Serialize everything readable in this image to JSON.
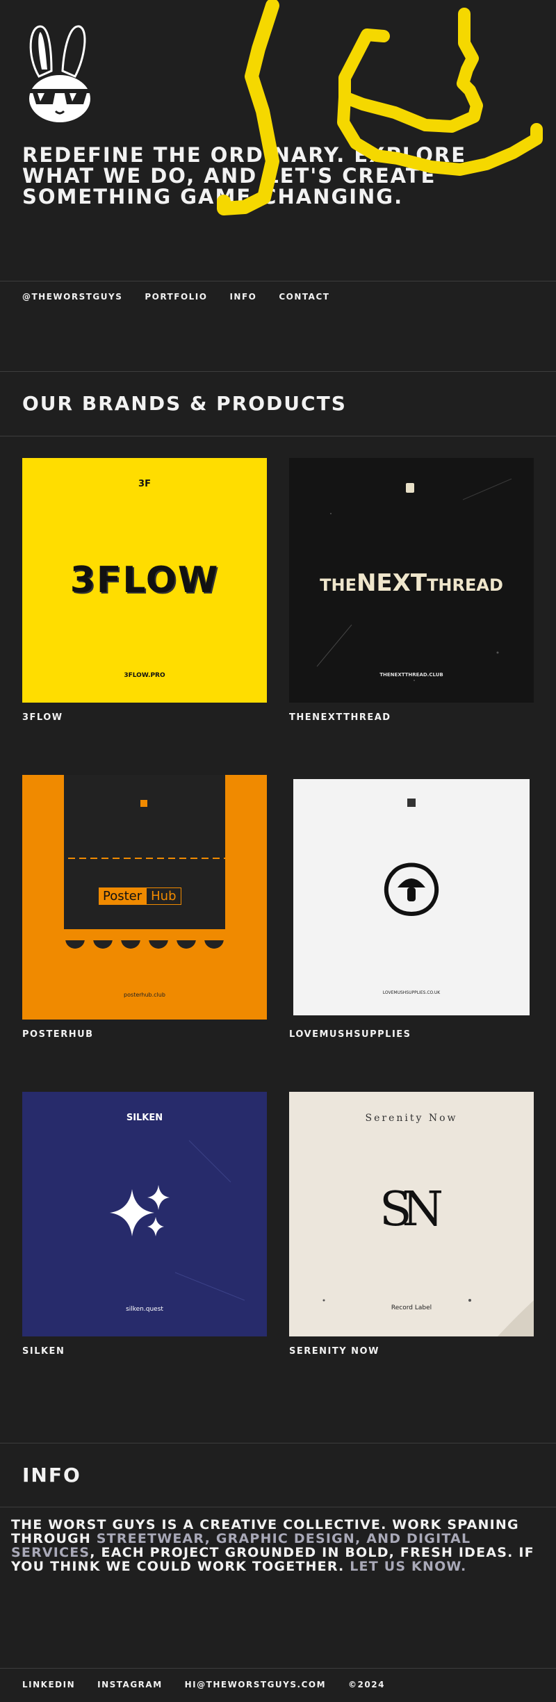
{
  "header": {
    "logo_name": "bunny-with-sunglasses-logo",
    "headline": "Redefine the ordinary. Explore what we do, and let's create something game-changing."
  },
  "nav": {
    "items": [
      "@theworstguys",
      "Portfolio",
      "Info",
      "Contact"
    ]
  },
  "brands": {
    "title": "Our Brands & Products",
    "items": [
      {
        "name": "3FLOW",
        "logo_small": "3F",
        "logo_big": "3FLOW",
        "url": "3FLOW.PRO"
      },
      {
        "name": "THENEXTTHREAD",
        "logo_the": "THE",
        "logo_next": "NEXT",
        "logo_thread": "THREAD",
        "url": "THENEXTTHREAD.CLUB"
      },
      {
        "name": "POSTERHUB",
        "logo_left": "Poster",
        "logo_right": "Hub",
        "url": "posterhub.club"
      },
      {
        "name": "LOVEMUSHSUPPLIES",
        "url": "LOVEMUSHSUPPLIES.CO.UK"
      },
      {
        "name": "SILKEN",
        "logo": "SILKEN",
        "url": "silken.quest"
      },
      {
        "name": "SERENITY NOW",
        "logo_top": "Serenity Now",
        "logo_mono_s": "S",
        "logo_mono_n": "N",
        "subtitle": "Record Label"
      }
    ]
  },
  "info": {
    "title": "Info",
    "text_1": "The worst guys is a creative collective. Work spaning through ",
    "link_1": "streetwear, graphic design, and digital services",
    "text_2": ", each project grounded in bold, fresh ideas. If you think we could work together. ",
    "link_2": "Let us know."
  },
  "footer": {
    "items": [
      "LinkedIn",
      "Instagram",
      "hi@theworstguys.com",
      "©2024"
    ]
  },
  "colors": {
    "background": "#1f1f1f",
    "scribble": "#f5d800",
    "flow_yellow": "#ffdd00",
    "posterhub_orange": "#f08a00",
    "silken_blue": "#272b6b",
    "serenity_cream": "#ece6dc"
  }
}
